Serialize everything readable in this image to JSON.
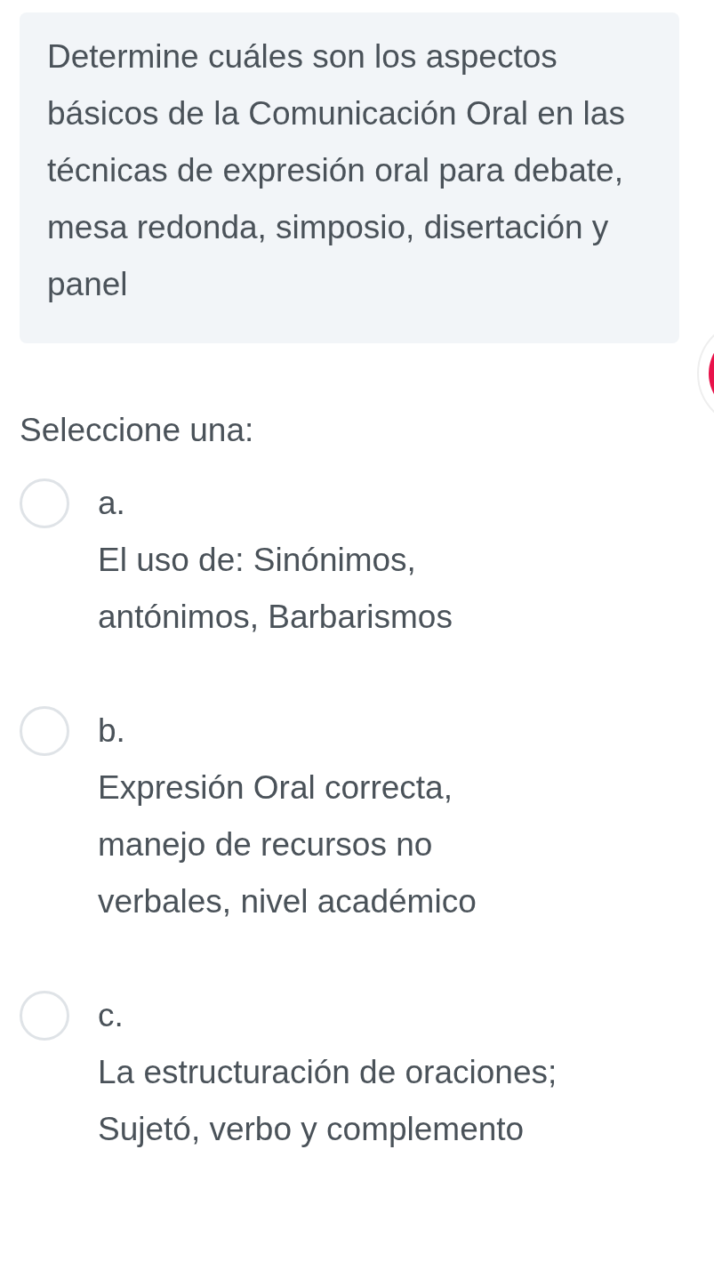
{
  "question": {
    "text": "Determine cuáles son los aspectos básicos de la Comunicación Oral en las técnicas de expresión oral para debate, mesa redonda, simposio, disertación y panel"
  },
  "prompt": "Seleccione una:",
  "options": [
    {
      "letter": "a.",
      "text": "El uso de: Sinónimos, antónimos, Barbarismos",
      "selected": false
    },
    {
      "letter": "b.",
      "text": "Expresión Oral correcta, manejo de recursos no verbales, nivel académico",
      "selected": false
    },
    {
      "letter": "c.",
      "text": "La estructuración de oraciones; Sujetó, verbo y complemento",
      "selected": false
    }
  ]
}
